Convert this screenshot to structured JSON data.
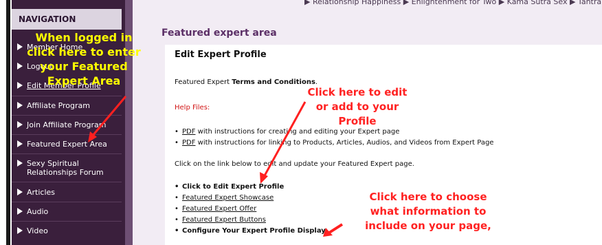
{
  "top_breadcrumb": "▶ Relationship Happiness  ▶ Enlightenment for Two  ▶ Kama Sutra Sex  ▶ Tantra",
  "sidebar": {
    "heading": "NAVIGATION",
    "items": [
      {
        "label": "Member Home"
      },
      {
        "label": "Logout"
      },
      {
        "label": "Edit Member Profile"
      },
      {
        "label": "Affiliate Program"
      },
      {
        "label": "Join Affiliate Program"
      },
      {
        "label": "Featured Expert Area"
      },
      {
        "label": "Sexy Spiritual Relationships Forum",
        "line1": "Sexy Spiritual",
        "line2": "Relationships Forum"
      },
      {
        "label": "Articles"
      },
      {
        "label": "Audio"
      },
      {
        "label": "Video"
      }
    ]
  },
  "main": {
    "section_title": "Featured expert area",
    "edit_heading": "Edit Expert Profile",
    "terms_prefix": "Featured Expert ",
    "terms_bold": "Terms and Conditions",
    "terms_suffix": ".",
    "help_files": "Help Files:",
    "help_links": [
      {
        "link": "PDF",
        "text": " with instructions for creating and editing your Expert page"
      },
      {
        "link": "PDF",
        "text": " with instructions for linking to Products, Articles, Audios, and Videos from Expert Page"
      }
    ],
    "instruction": "Click on the link below to edit and update your Featured Expert page.",
    "actions": [
      {
        "label": "Click to Edit Expert Profile",
        "style": "bold"
      },
      {
        "label": "Featured Expert Showcase",
        "style": "link"
      },
      {
        "label": "Featured Expert Offer",
        "style": "link"
      },
      {
        "label": "Featured Expert Buttons",
        "style": "link"
      },
      {
        "label": "Configure Your Expert Profile Display",
        "style": "bold"
      }
    ]
  },
  "annotations": {
    "yellow_note": [
      "When logged in",
      "click here to enter",
      "your Featured",
      "Expert Area"
    ],
    "red_note_1": [
      "Click here to edit",
      "or add to your",
      "Profile"
    ],
    "red_note_2": [
      "Click here to choose",
      "what information to",
      "include on your page,"
    ]
  },
  "colors": {
    "sidebar_bg": "#3a1f3c",
    "accent_purple": "#5c3067",
    "annotation_yellow": "#ffff00",
    "annotation_red": "#ff2222"
  }
}
